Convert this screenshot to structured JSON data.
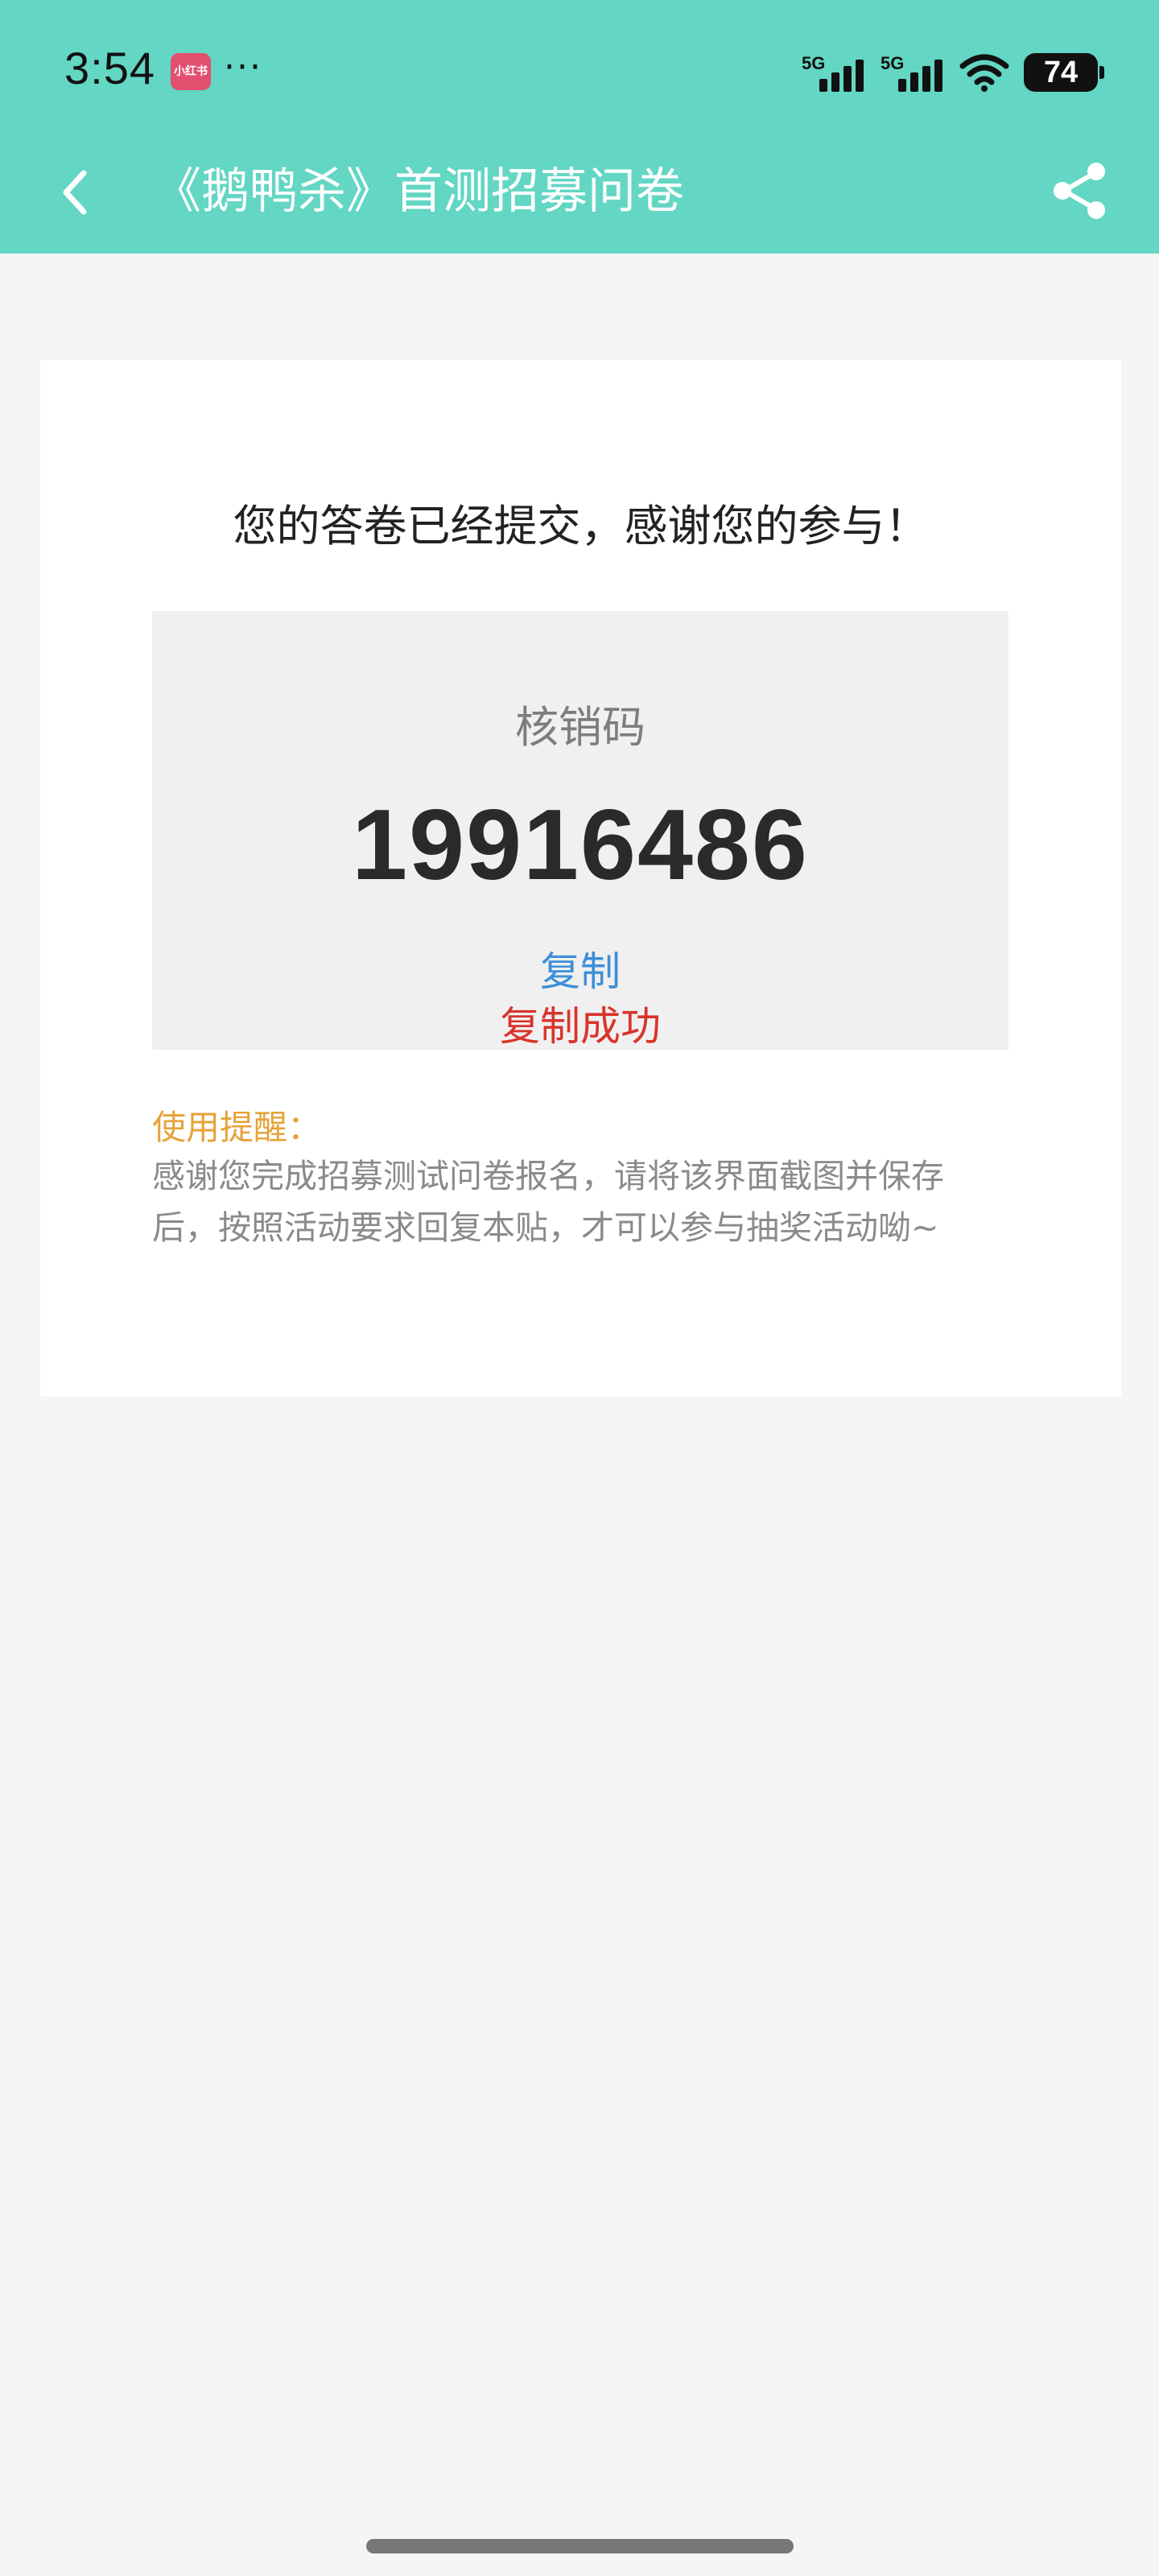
{
  "status_bar": {
    "time": "3:54",
    "app_badge": "小红书",
    "more_dots": "···",
    "signal_1_label": "5G",
    "signal_2_label": "5G",
    "battery": "74"
  },
  "nav": {
    "title": "《鹅鸭杀》首测招募问卷"
  },
  "result": {
    "thanks": "您的答卷已经提交，感谢您的参与！",
    "code_label": "核销码",
    "code_value": "19916486",
    "copy_label": "复制",
    "copy_success": "复制成功"
  },
  "reminder": {
    "title": "使用提醒：",
    "body": "感谢您完成招募测试问卷报名，请将该界面截图并保存后，按照活动要求回复本贴，才可以参与抽奖活动呦~"
  },
  "colors": {
    "header_bg": "#63d6c4",
    "link_blue": "#3d8fd8",
    "success_red": "#d9342b",
    "reminder_orange": "#e6a33a"
  },
  "icons": {
    "back": "chevron-left-icon",
    "share": "share-icon",
    "wifi": "wifi-icon"
  }
}
